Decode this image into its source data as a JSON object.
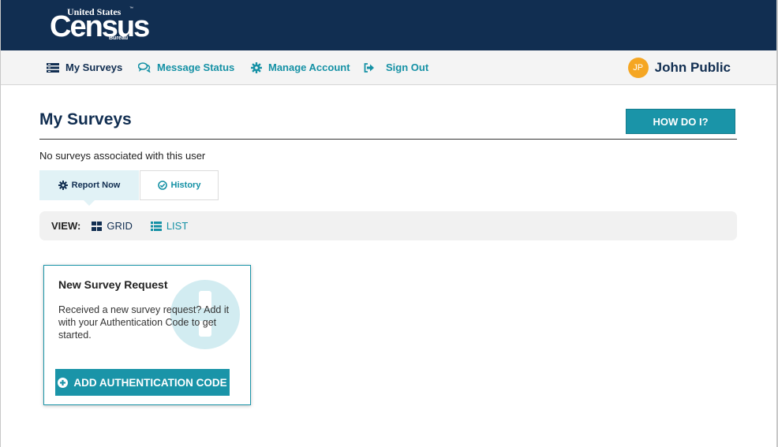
{
  "brand": {
    "line1": "United States",
    "tm": "™",
    "line2": "Census",
    "line3": "Bureau"
  },
  "nav": {
    "items": [
      {
        "label": "My Surveys",
        "icon": "surveys-icon"
      },
      {
        "label": "Message Status",
        "icon": "chat-icon"
      },
      {
        "label": "Manage Account",
        "icon": "gear-icon"
      },
      {
        "label": "Sign Out",
        "icon": "sign-out-icon"
      }
    ],
    "user": {
      "initials": "JP",
      "name": "John Public"
    }
  },
  "page": {
    "title": "My Surveys",
    "help_button": "HOW DO I?",
    "empty_message": "No surveys associated with this user"
  },
  "tabs": [
    {
      "label": "Report Now",
      "icon": "gear-icon",
      "active": true
    },
    {
      "label": "History",
      "icon": "check-circle-icon",
      "active": false
    }
  ],
  "view": {
    "label": "VIEW:",
    "options": [
      {
        "label": "GRID",
        "icon": "grid-icon",
        "selected": true
      },
      {
        "label": "LIST",
        "icon": "list-icon",
        "selected": false
      }
    ]
  },
  "card": {
    "title": "New Survey Request",
    "text": "Received a new survey request? Add it with your Authentication Code to get started.",
    "button": "ADD AUTHENTICATION CODE",
    "button_icon": "plus-circle-icon"
  },
  "colors": {
    "header_bg": "#112e51",
    "accent": "#1a94a8",
    "avatar": "#f5a623"
  }
}
